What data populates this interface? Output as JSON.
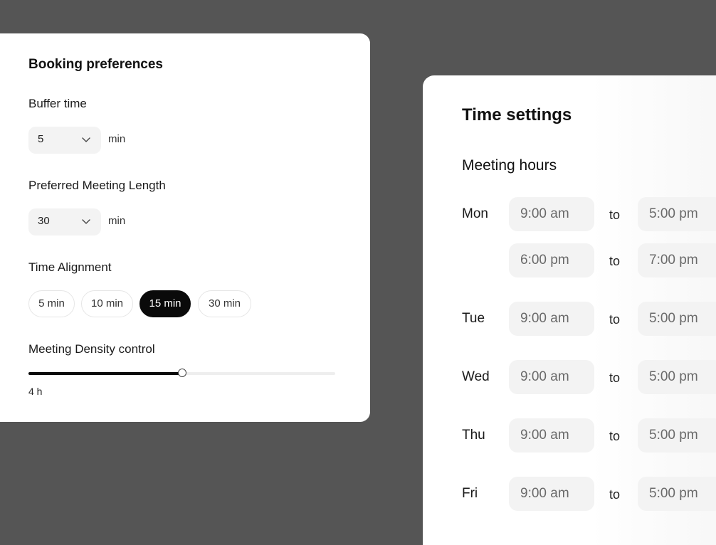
{
  "booking": {
    "title": "Booking preferences",
    "buffer": {
      "label": "Buffer time",
      "value": "5",
      "unit": "min"
    },
    "length": {
      "label": "Preferred Meeting Length",
      "value": "30",
      "unit": "min"
    },
    "alignment": {
      "label": "Time Alignment",
      "options": [
        "5 min",
        "10 min",
        "15 min",
        "30 min"
      ],
      "selected": "15 min"
    },
    "density": {
      "label": "Meeting Density control",
      "value_label": "4 h",
      "fraction": 0.5
    }
  },
  "time_settings": {
    "title": "Time settings",
    "subtitle": "Meeting hours",
    "to_word": "to",
    "days": [
      {
        "day": "Mon",
        "ranges": [
          {
            "from": "9:00 am",
            "to": "5:00 pm"
          },
          {
            "from": "6:00 pm",
            "to": "7:00 pm"
          }
        ]
      },
      {
        "day": "Tue",
        "ranges": [
          {
            "from": "9:00 am",
            "to": "5:00 pm"
          }
        ]
      },
      {
        "day": "Wed",
        "ranges": [
          {
            "from": "9:00 am",
            "to": "5:00 pm"
          }
        ]
      },
      {
        "day": "Thu",
        "ranges": [
          {
            "from": "9:00 am",
            "to": "5:00 pm"
          }
        ]
      },
      {
        "day": "Fri",
        "ranges": [
          {
            "from": "9:00 am",
            "to": "5:00 pm"
          }
        ]
      }
    ]
  },
  "colors": {
    "backdrop": "#555555",
    "accent": "#0a0a0a",
    "field_bg": "#f3f3f3"
  }
}
